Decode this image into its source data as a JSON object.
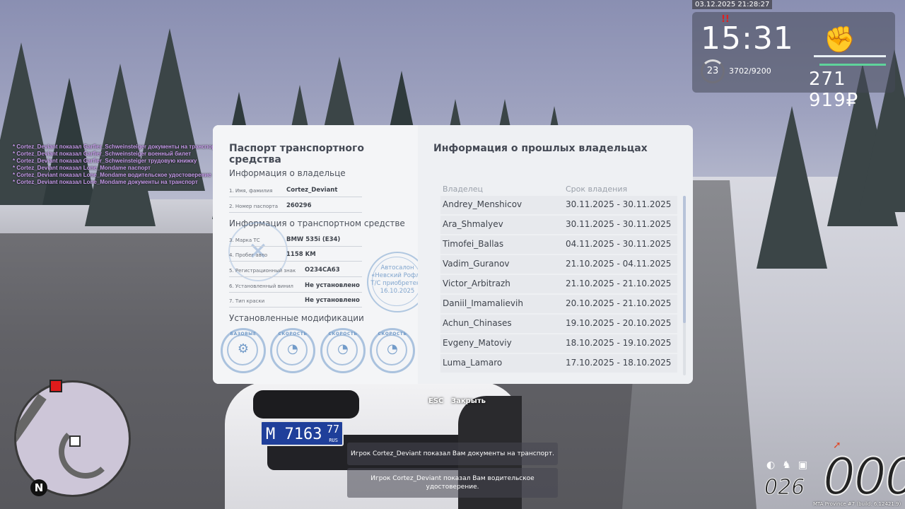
{
  "hud": {
    "datetime": "03.12.2025 21:28:27",
    "alert": "!!",
    "time": "15:31",
    "level": "23",
    "xp": "3702/9200",
    "fist_icon": "fist-icon",
    "money": "271 919₽"
  },
  "chat": [
    "* Cortez_Deviant показал Garfier_Schweinsteiger документы на транспорт",
    "* Cortez_Deviant показал Garfier_Schweinsteiger военный билет",
    "* Cortez_Deviant показал Garfier_Schweinsteiger трудовую книжку",
    "* Cortez_Deviant показал Lone_Mondame паспорт",
    "* Cortez_Deviant показал Lone_Mondame водительское удостоверение",
    "* Cortez_Deviant показал Lone_Mondame документы на транспорт"
  ],
  "passport": {
    "title": "Паспорт транспортного средства",
    "owner_section": "Информация о владельце",
    "owner_rows": [
      {
        "label": "1. Имя, фамилия",
        "value": "Cortez_Deviant"
      },
      {
        "label": "2. Номер паспорта",
        "value": "260296"
      }
    ],
    "vehicle_section": "Информация о транспортном средстве",
    "vehicle_rows": [
      {
        "label": "3. Марка ТС",
        "value": "BMW 535i (E34)"
      },
      {
        "label": "4. Пробег авто",
        "value": "1158 KM"
      },
      {
        "label": "5. Регистрационный знак",
        "value": "О234СА63"
      },
      {
        "label": "6. Установленный винил",
        "value": "Не установлено"
      },
      {
        "label": "7. Тип краски",
        "value": "Не установлено"
      }
    ],
    "dealer_stamp": {
      "line1": "Автосалон",
      "line2": "«Невский Рофл»",
      "line3": "Т/С приобретено",
      "date": "16.10.2025"
    },
    "mods_section": "Установленные модификации",
    "mods": [
      {
        "label": "БАЗОВЫЕ",
        "icon": "gear-icon"
      },
      {
        "label": "СКОРОСТЬ",
        "icon": "speedometer-icon"
      },
      {
        "label": "СКОРОСТЬ",
        "icon": "speedometer-icon"
      },
      {
        "label": "СКОРОСТЬ",
        "icon": "speedometer-icon"
      }
    ]
  },
  "owners": {
    "title": "Информация о прошлых владельцах",
    "col_owner": "Владелец",
    "col_period": "Срок владения",
    "rows": [
      {
        "name": "Andrey_Menshicov",
        "period": "30.11.2025 - 30.11.2025"
      },
      {
        "name": "Ara_Shmalyev",
        "period": "30.11.2025 - 30.11.2025"
      },
      {
        "name": "Timofei_Ballas",
        "period": "04.11.2025 - 30.11.2025"
      },
      {
        "name": "Vadim_Guranov",
        "period": "21.10.2025 - 04.11.2025"
      },
      {
        "name": "Victor_Arbitrazh",
        "period": "21.10.2025 - 21.10.2025"
      },
      {
        "name": "Daniil_Imamalievih",
        "period": "20.10.2025 - 21.10.2025"
      },
      {
        "name": "Achun_Chinases",
        "period": "19.10.2025 - 20.10.2025"
      },
      {
        "name": "Evgeny_Matoviy",
        "period": "18.10.2025 - 19.10.2025"
      },
      {
        "name": "Luma_Lamaro",
        "period": "17.10.2025 - 18.10.2025"
      }
    ]
  },
  "controls": {
    "esc": "ESC",
    "close": "Закрыть"
  },
  "notifications": [
    "Игрок Cortez_Deviant показал Вам документы на транспорт.",
    "Игрок Cortez_Deviant показал Вам водительское удостоверение."
  ],
  "plate": {
    "number": "М 7163",
    "region": "77",
    "country": "RUS"
  },
  "minimap": {
    "north": "N"
  },
  "speedometer": {
    "speed": "000",
    "gear": "026"
  },
  "build": "MTA Province #7 (build: 6.12421.9)"
}
